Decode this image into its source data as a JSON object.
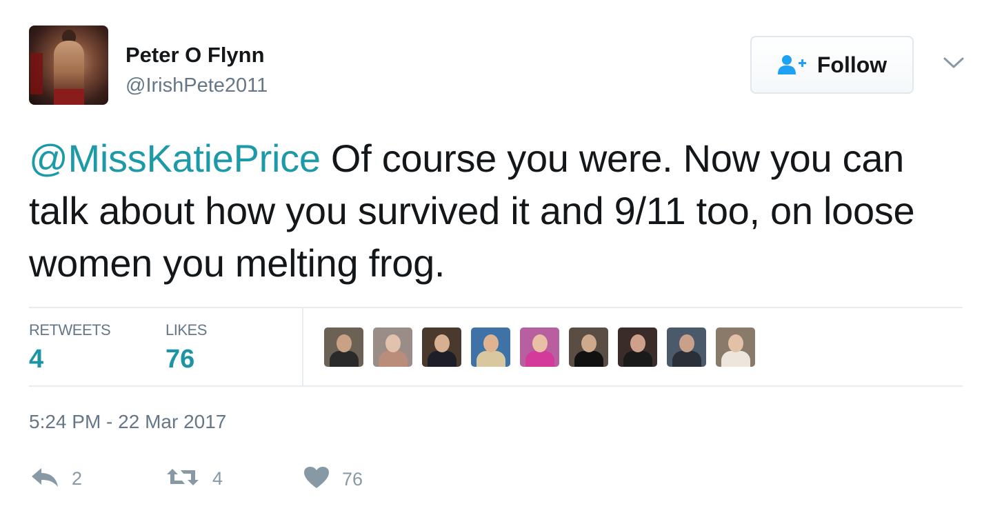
{
  "user": {
    "name": "Peter O Flynn",
    "handle": "@IrishPete2011"
  },
  "follow_button": {
    "label": "Follow",
    "icon": "add-user-icon"
  },
  "menu_icon": "chevron-down-icon",
  "tweet": {
    "mention": "@MissKatiePrice",
    "text": " Of course you were. Now you can talk about how you survived it and 9/11 too, on loose women you melting frog."
  },
  "stats": {
    "retweets_label": "RETWEETS",
    "retweets_value": "4",
    "likes_label": "LIKES",
    "likes_value": "76"
  },
  "likers": [
    {
      "name": "liker-avatar-1",
      "bg": "#6b6255",
      "face": "#c9a184",
      "body": "#2a2a2a"
    },
    {
      "name": "liker-avatar-2",
      "bg": "#9a8c86",
      "face": "#e1c2ad",
      "body": "#b98d7a"
    },
    {
      "name": "liker-avatar-3",
      "bg": "#4a3a2e",
      "face": "#d6b091",
      "body": "#1e1e28"
    },
    {
      "name": "liker-avatar-4",
      "bg": "#3f73a8",
      "face": "#e0b391",
      "body": "#d9c7a0"
    },
    {
      "name": "liker-avatar-5",
      "bg": "#b85fa0",
      "face": "#e9c0a5",
      "body": "#d43a9a"
    },
    {
      "name": "liker-avatar-6",
      "bg": "#5a4e44",
      "face": "#cfa98b",
      "body": "#111111"
    },
    {
      "name": "liker-avatar-7",
      "bg": "#3a2c28",
      "face": "#cfa08a",
      "body": "#1a1a1a"
    },
    {
      "name": "liker-avatar-8",
      "bg": "#4b5a6a",
      "face": "#c9a18a",
      "body": "#2a2f38"
    },
    {
      "name": "liker-avatar-9",
      "bg": "#8a7a6a",
      "face": "#e2c1a6",
      "body": "#ece6dc"
    }
  ],
  "timestamp": "5:24 PM - 22 Mar 2017",
  "actions": {
    "reply_count": "2",
    "retweet_count": "4",
    "like_count": "76"
  },
  "colors": {
    "accent": "#1b95a5",
    "muted": "#657786",
    "icon": "#8899a6",
    "follow_icon": "#1da1f2"
  }
}
